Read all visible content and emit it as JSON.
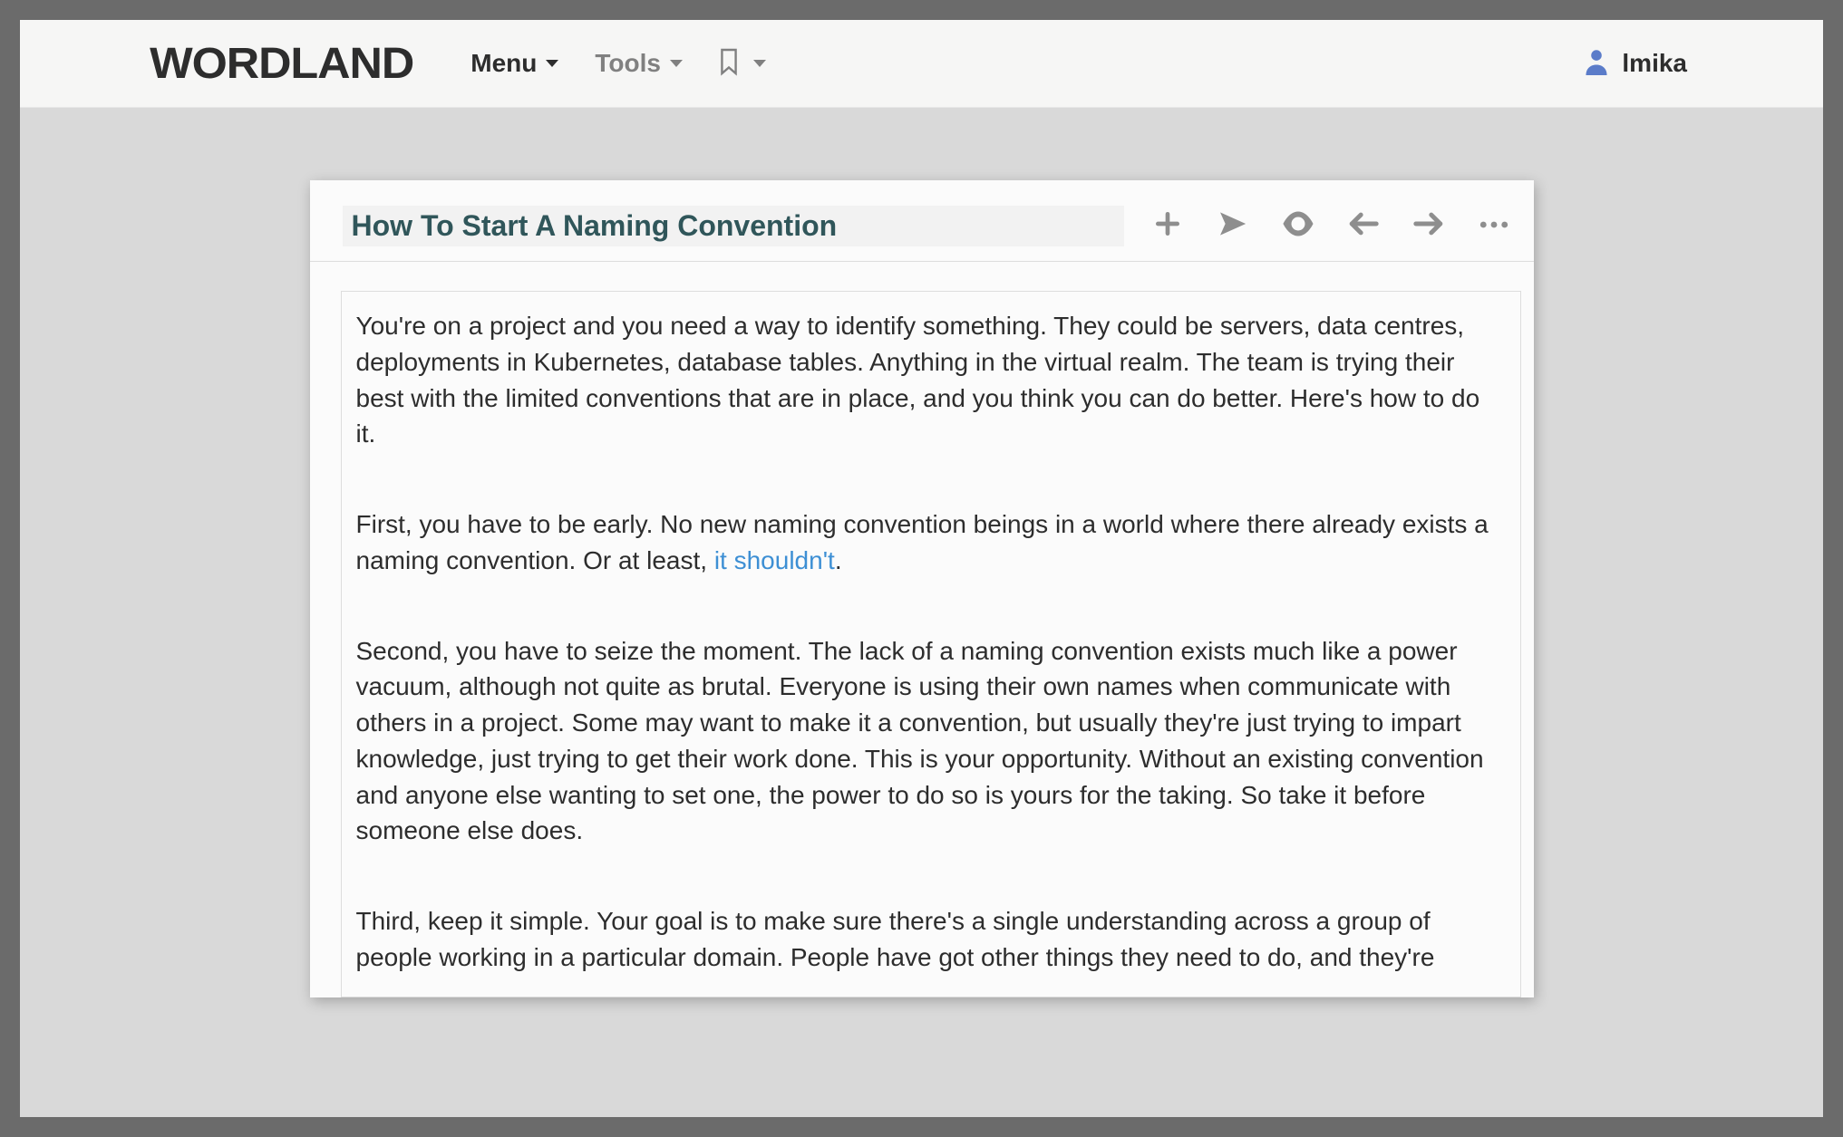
{
  "brand": "WORDLAND",
  "nav": {
    "menu_label": "Menu",
    "tools_label": "Tools"
  },
  "user": {
    "name": "lmika"
  },
  "icons": {
    "bookmark": "bookmark",
    "user": "user",
    "plus": "plus",
    "send": "paper-plane",
    "eye": "eye",
    "prev": "arrow-left",
    "next": "arrow-right",
    "more": "ellipsis"
  },
  "document": {
    "title": "How To Start A Naming Convention",
    "paragraphs": [
      {
        "segments": [
          {
            "text": "You're on a project and you need a way to identify something. They could be servers, data centres, deployments in Kubernetes, database tables. Anything in the virtual realm. The team is trying their best with the limited conventions that are in place, and you think you can do better. Here's how to do it."
          }
        ]
      },
      {
        "segments": [
          {
            "text": "First, you have to be early. No new naming convention beings in a world where there already exists a naming convention. Or at least, "
          },
          {
            "text": "it shouldn't",
            "link": true
          },
          {
            "text": "."
          }
        ]
      },
      {
        "segments": [
          {
            "text": "Second, you have to seize the moment. The lack of a naming convention exists much like a power vacuum, although not quite as brutal. Everyone is using their own names when  communicate with others in a project. Some may want to make it a convention, but usually they're just trying to impart knowledge, just trying to get their work done. This is your opportunity. Without an existing convention and anyone else wanting to set one, the power to do so is yours for the taking. So take it before someone else does."
          }
        ]
      },
      {
        "segments": [
          {
            "text": "Third, keep it simple. Your goal is to make sure there's a single understanding across a group of people working in a particular domain. People have got other things they need to do, and they're"
          }
        ]
      }
    ]
  }
}
